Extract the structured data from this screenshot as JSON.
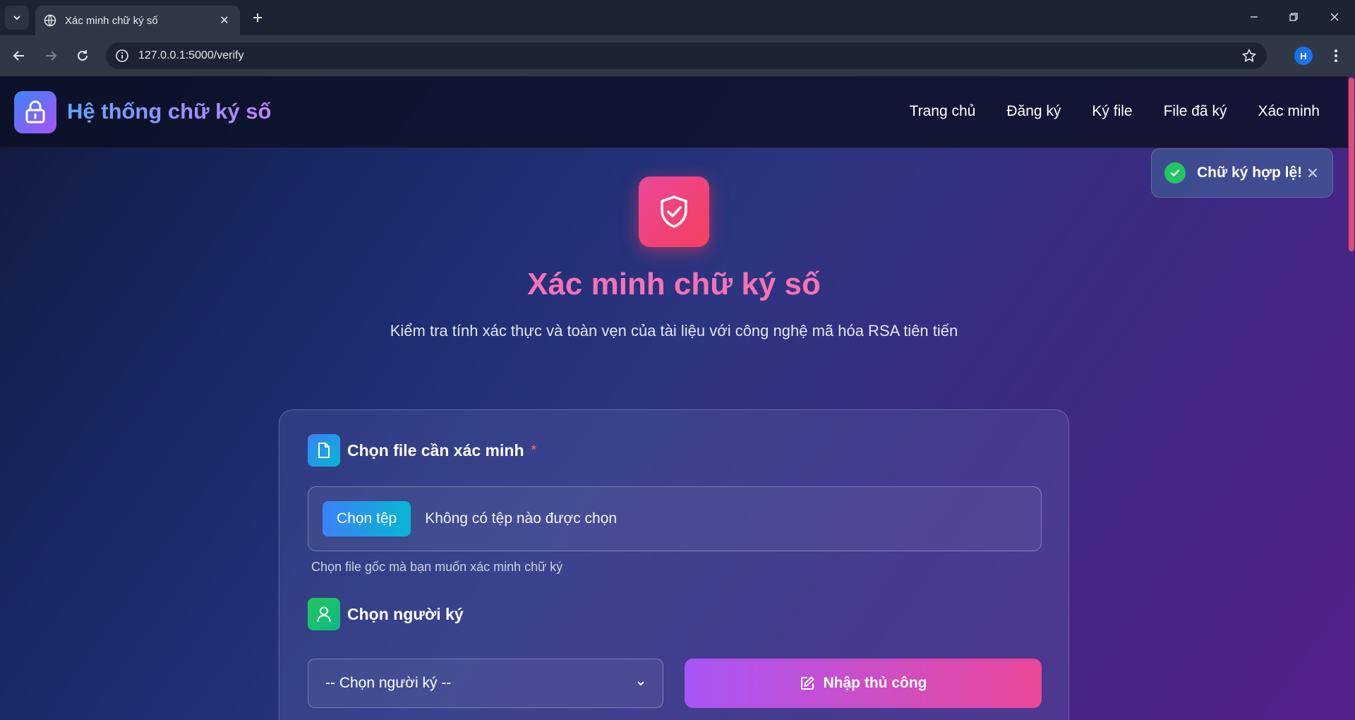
{
  "browser": {
    "tab_title": "Xác minh chữ ký số",
    "url": "127.0.0.1:5000/verify",
    "profile_initial": "H"
  },
  "header": {
    "brand": "Hệ thống chữ ký số",
    "nav": [
      "Trang chủ",
      "Đăng ký",
      "Ký file",
      "File đã ký",
      "Xác minh"
    ]
  },
  "toast": {
    "message": "Chữ ký hợp lệ!"
  },
  "hero": {
    "title": "Xác minh chữ ký số",
    "subtitle": "Kiểm tra tính xác thực và toàn vẹn của tài liệu với công nghệ mã hóa RSA tiên tiến"
  },
  "form": {
    "file_section": {
      "title": "Chọn file cần xác minh",
      "required_mark": "*",
      "button_label": "Chọn tệp",
      "file_status": "Không có tệp nào được chọn",
      "hint": "Chọn file gốc mà bạn muốn xác minh chữ ký"
    },
    "signer_section": {
      "title": "Chọn người ký",
      "select_value": "-- Chọn người ký --",
      "manual_button": "Nhập thủ công"
    }
  },
  "colors": {
    "accent_pink": "#f472b6",
    "success": "#22c55e",
    "brand_gradient_start": "#60a5fa",
    "brand_gradient_end": "#c084fc"
  }
}
